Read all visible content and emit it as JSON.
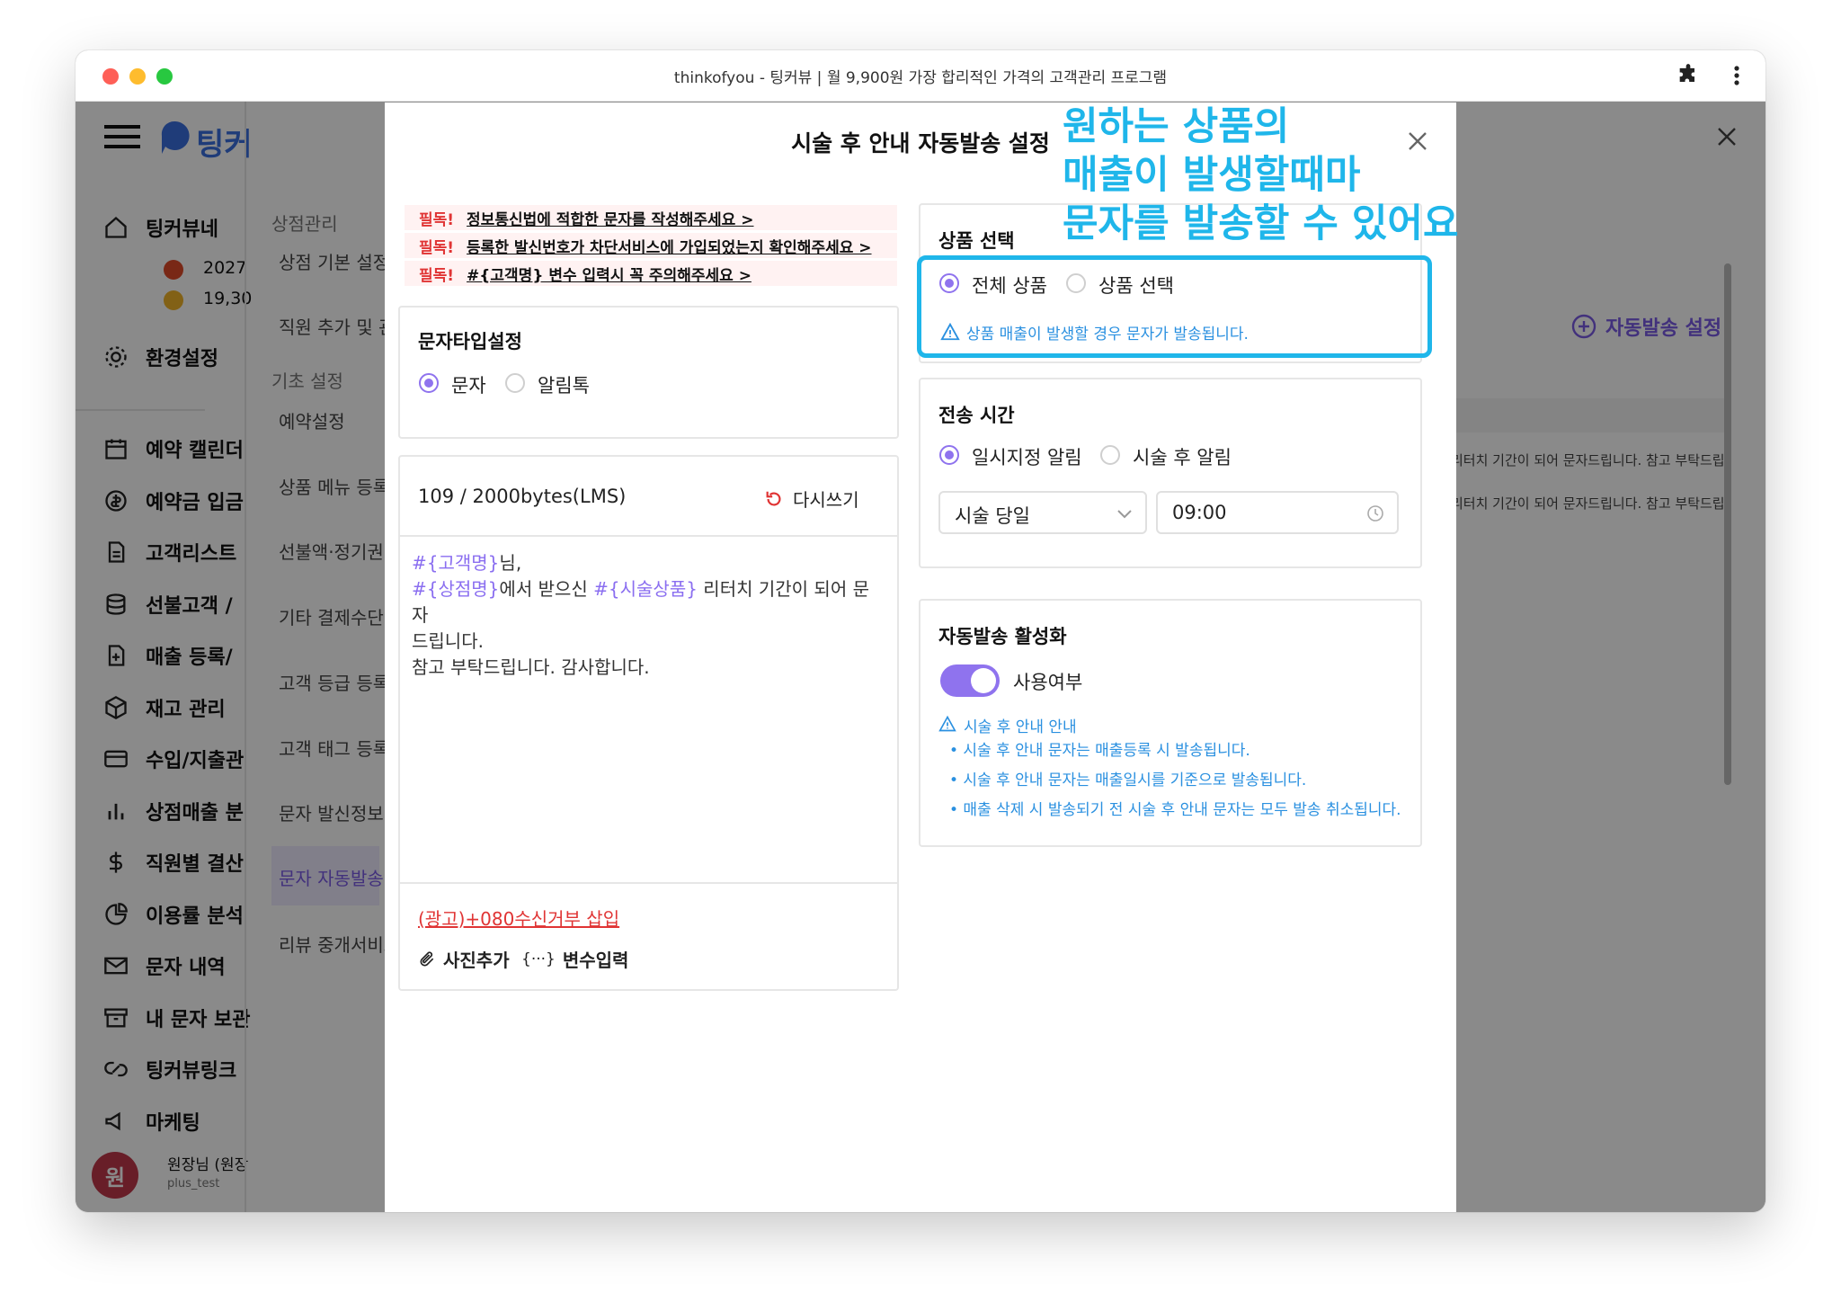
{
  "window": {
    "title": "thinkofyou - 팅커뷰 | 월 9,900원 가장 합리적인 가격의 고객관리 프로그램",
    "traffic_colors": [
      "#fe5f57",
      "#febc2e",
      "#28c840"
    ]
  },
  "app": {
    "logo_text": "팅커",
    "shop_name": "팅커뷰네",
    "date_line": "2027",
    "point_line": "19,30",
    "settings": "환경설정",
    "nav": [
      {
        "icon": "calendar-icon",
        "label": "예약 캘린더"
      },
      {
        "icon": "deposit-icon",
        "label": "예약금 입금"
      },
      {
        "icon": "document-icon",
        "label": "고객리스트"
      },
      {
        "icon": "database-icon",
        "label": "선불고객 /"
      },
      {
        "icon": "file-plus-icon",
        "label": "매출 등록/"
      },
      {
        "icon": "box-icon",
        "label": "재고 관리"
      },
      {
        "icon": "card-icon",
        "label": "수입/지출관"
      },
      {
        "icon": "bar-chart-icon",
        "label": "상점매출 분"
      },
      {
        "icon": "dollar-icon",
        "label": "직원별 결산"
      },
      {
        "icon": "pie-icon",
        "label": "이용률 분석"
      },
      {
        "icon": "mail-icon",
        "label": "문자 내역"
      },
      {
        "icon": "archive-icon",
        "label": "내 문자 보관"
      },
      {
        "icon": "link-icon",
        "label": "팅커뷰링크"
      },
      {
        "icon": "megaphone-icon",
        "label": "마케팅"
      }
    ],
    "user": {
      "avatar": "원",
      "name": "원장님 (원장",
      "id": "plus_test"
    },
    "sub_section1": "상점관리",
    "sub_items1": [
      "상점 기본 설정",
      "직원 추가 및 관리"
    ],
    "sub_section2": "기초 설정",
    "sub_items2": [
      "예약설정",
      "상품 메뉴 등록",
      "선불액·정기권",
      "기타 결제수단 설정",
      "고객 등급 등록",
      "고객 태그 등록",
      "문자 발신정보 등록",
      "문자 자동발송 설정",
      "리뷰 중개서비스"
    ],
    "auto_send_button": "자동발송 설정",
    "bg_rows": [
      "리터치 기간이 되어 문자드립니다. 참고 부탁드립니다",
      "리터치 기간이 되어 문자드립니다. 참고 부탁드립니다"
    ]
  },
  "modal": {
    "title": "시술 후 안내 자동발송 설정",
    "notices": [
      {
        "tag": "필독!",
        "text": "정보통신법에 적합한 문자를 작성해주세요 >"
      },
      {
        "tag": "필독!",
        "text": "등록한 발신번호가 차단서비스에 가입되었는지 확인해주세요 >"
      },
      {
        "tag": "필독!",
        "text": "#{고객명} 변수 입력시 꼭 주의해주세요 >"
      }
    ],
    "msg_type": {
      "title": "문자타입설정",
      "options": [
        "문자",
        "알림톡"
      ]
    },
    "editor": {
      "bytes": "109 / 2000bytes(LMS)",
      "rewrite": "다시쓰기",
      "var_customer": "#{고객명}",
      "line1_rest": "님,",
      "var_shop": "#{상점명}",
      "line2_mid": "에서 받으신 ",
      "var_product": "#{시술상품}",
      "line2_end": " 리터치 기간이 되어 문자",
      "line3": "드립니다.",
      "line4": "참고 부탁드립니다. 감사합니다.",
      "ad_link": "(광고)+080수신거부 삽입",
      "photo": "사진추가",
      "var_icon": "{···}",
      "var_input": "변수입력"
    },
    "product": {
      "title": "상품 선택",
      "options": [
        "전체 상품",
        "상품 선택"
      ],
      "hint": "상품 매출이 발생할 경우 문자가 발송됩니다."
    },
    "send_time": {
      "title": "전송 시간",
      "options": [
        "일시지정 알림",
        "시술 후 알림"
      ],
      "day": "시술 당일",
      "time": "09:00"
    },
    "activate": {
      "title": "자동발송 활성화",
      "toggle_label": "사용여부",
      "toggle_on": true,
      "info_title": "시술 후 안내 안내",
      "info_items": [
        "• 시술 후 안내 문자는 매출등록 시 발송됩니다.",
        "• 시술 후 안내 문자는 매출일시를 기준으로 발송됩니다.",
        "• 매출 삭제 시 발송되기 전 시술 후 안내 문자는 모두 발송 취소됩니다."
      ]
    }
  },
  "annotation": {
    "lines": [
      "원하는 상품의",
      "매출이 발생할때마",
      "문자를 발송할 수 있어요"
    ],
    "color": "#1fb6ea"
  },
  "colors": {
    "accent": "#8f73ee",
    "danger": "#e03434",
    "info": "#2a90e0"
  }
}
